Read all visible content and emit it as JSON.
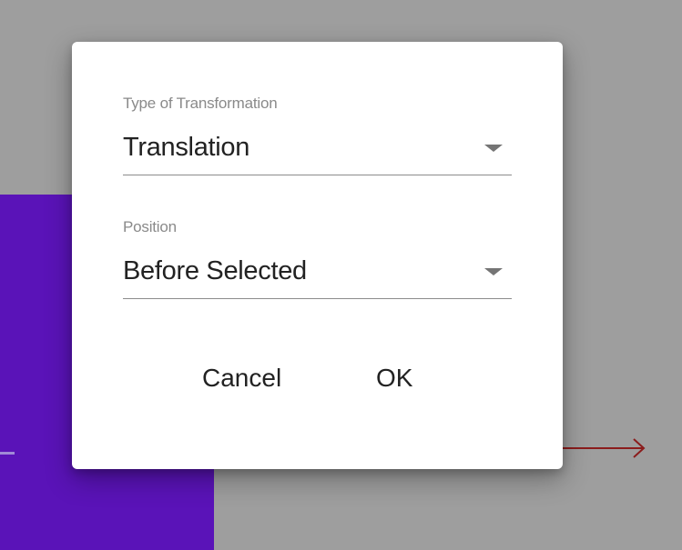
{
  "background": {
    "overlay_color": "#9e9e9e",
    "block_color": "#5a13b8",
    "arrow_color": "#8b1c1c",
    "arrow_icon": "arrow-right-icon"
  },
  "dialog": {
    "type_field": {
      "label": "Type of Transformation",
      "value": "Translation",
      "icon": "dropdown-caret-icon"
    },
    "position_field": {
      "label": "Position",
      "value": "Before Selected",
      "icon": "dropdown-caret-icon"
    },
    "actions": {
      "cancel_label": "Cancel",
      "ok_label": "OK"
    }
  }
}
